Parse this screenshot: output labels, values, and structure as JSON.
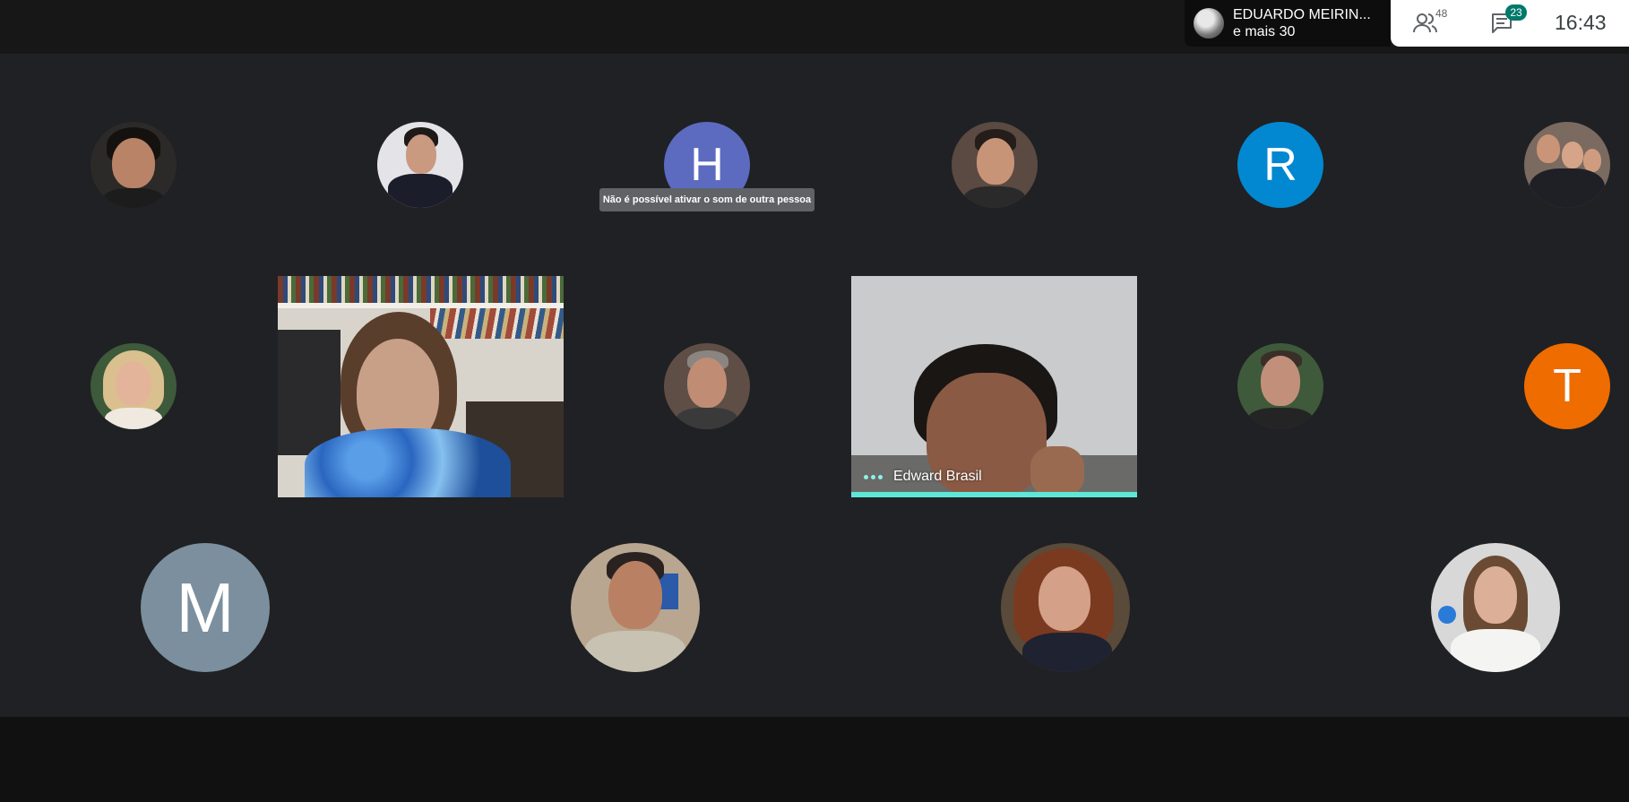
{
  "presenter": {
    "name": "EDUARDO MEIRIN...",
    "more": "e mais 30"
  },
  "toolbar": {
    "participants_count": "48",
    "chat_badge": "23",
    "clock": "16:43"
  },
  "tooltip": "Não é possível ativar o som de outra pessoa",
  "tiles": {
    "h": {
      "letter": "H",
      "color": "#5c6bc0"
    },
    "r": {
      "letter": "R",
      "color": "#0288d1"
    },
    "t": {
      "letter": "T",
      "color": "#ef6c00"
    },
    "m": {
      "letter": "M",
      "color": "#7b8f9e"
    }
  },
  "videos": {
    "speaker_name": "Edward Brasil"
  }
}
